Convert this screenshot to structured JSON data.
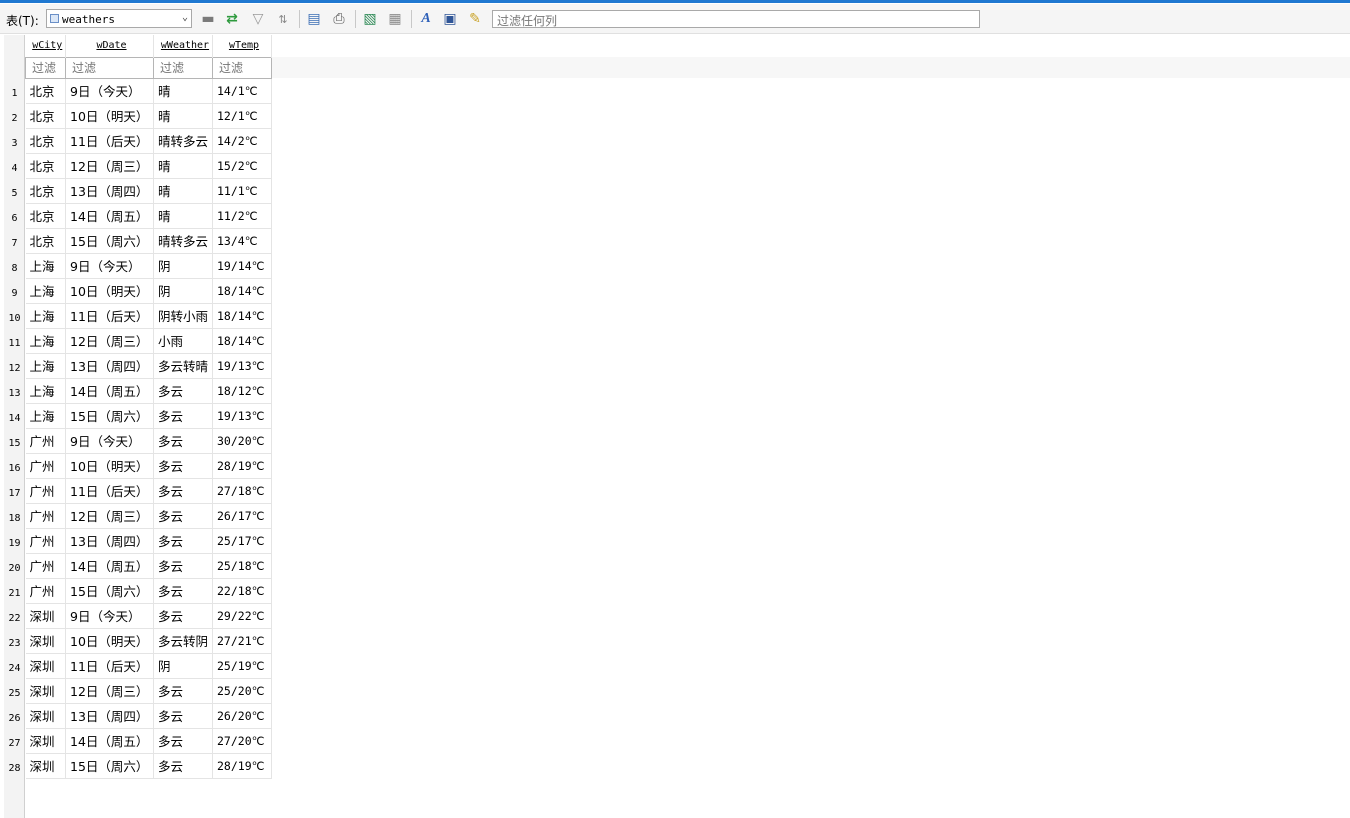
{
  "toolbar": {
    "table_label": "表(T):",
    "table_value": "weathers",
    "filter_placeholder": "过滤任何列",
    "icons": [
      "add-row-icon",
      "refresh-icon",
      "filter-icon",
      "sort-icon",
      "export-icon",
      "print-icon",
      "import-icon",
      "save-icon",
      "font-icon",
      "find-icon",
      "edit-icon"
    ]
  },
  "grid": {
    "columns": [
      "wCity",
      "wDate",
      "wWeather",
      "wTemp"
    ],
    "filter_placeholder": "过滤",
    "rows": [
      [
        "北京",
        "9日（今天）",
        "晴",
        "14/1℃"
      ],
      [
        "北京",
        "10日（明天）",
        "晴",
        "12/1℃"
      ],
      [
        "北京",
        "11日（后天）",
        "晴转多云",
        "14/2℃"
      ],
      [
        "北京",
        "12日（周三）",
        "晴",
        "15/2℃"
      ],
      [
        "北京",
        "13日（周四）",
        "晴",
        "11/1℃"
      ],
      [
        "北京",
        "14日（周五）",
        "晴",
        "11/2℃"
      ],
      [
        "北京",
        "15日（周六）",
        "晴转多云",
        "13/4℃"
      ],
      [
        "上海",
        "9日（今天）",
        "阴",
        "19/14℃"
      ],
      [
        "上海",
        "10日（明天）",
        "阴",
        "18/14℃"
      ],
      [
        "上海",
        "11日（后天）",
        "阴转小雨",
        "18/14℃"
      ],
      [
        "上海",
        "12日（周三）",
        "小雨",
        "18/14℃"
      ],
      [
        "上海",
        "13日（周四）",
        "多云转晴",
        "19/13℃"
      ],
      [
        "上海",
        "14日（周五）",
        "多云",
        "18/12℃"
      ],
      [
        "上海",
        "15日（周六）",
        "多云",
        "19/13℃"
      ],
      [
        "广州",
        "9日（今天）",
        "多云",
        "30/20℃"
      ],
      [
        "广州",
        "10日（明天）",
        "多云",
        "28/19℃"
      ],
      [
        "广州",
        "11日（后天）",
        "多云",
        "27/18℃"
      ],
      [
        "广州",
        "12日（周三）",
        "多云",
        "26/17℃"
      ],
      [
        "广州",
        "13日（周四）",
        "多云",
        "25/17℃"
      ],
      [
        "广州",
        "14日（周五）",
        "多云",
        "25/18℃"
      ],
      [
        "广州",
        "15日（周六）",
        "多云",
        "22/18℃"
      ],
      [
        "深圳",
        "9日（今天）",
        "多云",
        "29/22℃"
      ],
      [
        "深圳",
        "10日（明天）",
        "多云转阴",
        "27/21℃"
      ],
      [
        "深圳",
        "11日（后天）",
        "阴",
        "25/19℃"
      ],
      [
        "深圳",
        "12日（周三）",
        "多云",
        "25/20℃"
      ],
      [
        "深圳",
        "13日（周四）",
        "多云",
        "26/20℃"
      ],
      [
        "深圳",
        "14日（周五）",
        "多云",
        "27/20℃"
      ],
      [
        "深圳",
        "15日（周六）",
        "多云",
        "28/19℃"
      ]
    ]
  }
}
